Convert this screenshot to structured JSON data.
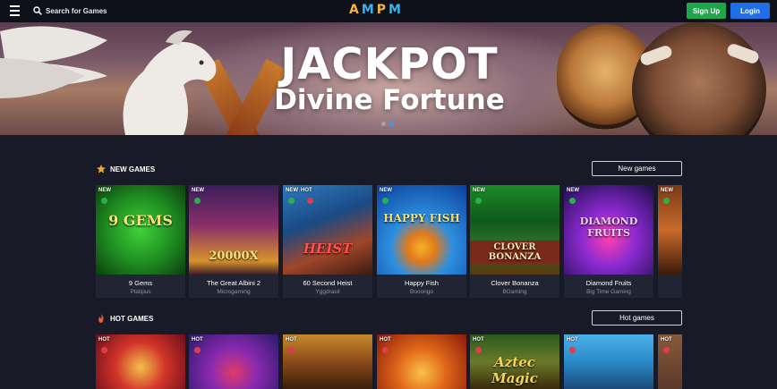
{
  "header": {
    "search_placeholder": "Search for Games",
    "logo_letters": [
      "A",
      "M",
      "P",
      "M"
    ],
    "signup_label": "Sign Up",
    "login_label": "Login"
  },
  "banner": {
    "title": "JACKPOT",
    "subtitle": "Divine Fortune",
    "slide_count": 2,
    "active_slide": 2
  },
  "new_games": {
    "title": "NEW GAMES",
    "button_label": "New games",
    "items": [
      {
        "name": "9 Gems",
        "provider": "Platipus",
        "badges": [
          "NEW"
        ],
        "art": "9 GEMS"
      },
      {
        "name": "The Great Albini 2",
        "provider": "Microgaming",
        "badges": [
          "NEW"
        ],
        "art": "20000X"
      },
      {
        "name": "60 Second Heist",
        "provider": "Yggdrasil",
        "badges": [
          "NEW",
          "HOT"
        ],
        "art": "HEIST"
      },
      {
        "name": "Happy Fish",
        "provider": "Booongo",
        "badges": [
          "NEW"
        ],
        "art": "HAPPY FISH"
      },
      {
        "name": "Clover Bonanza",
        "provider": "BGaming",
        "badges": [
          "NEW"
        ],
        "art": "CLOVER BONANZA"
      },
      {
        "name": "Diamond Fruits",
        "provider": "Big Time Gaming",
        "badges": [
          "NEW"
        ],
        "art": "DIAMOND FRUITS"
      },
      {
        "name": "",
        "provider": "",
        "badges": [
          "NEW"
        ],
        "art": ""
      }
    ]
  },
  "hot_games": {
    "title": "HOT GAMES",
    "button_label": "Hot games",
    "items": [
      {
        "badges": [
          "HOT"
        ]
      },
      {
        "badges": [
          "HOT"
        ]
      },
      {
        "badges": [
          "HOT"
        ]
      },
      {
        "badges": [
          "HOT"
        ]
      },
      {
        "badges": [
          "HOT"
        ],
        "art": "Aztec Magic"
      },
      {
        "badges": [
          "HOT"
        ]
      },
      {
        "badges": [
          "HOT"
        ]
      }
    ]
  },
  "colors": {
    "background": "#181b27",
    "topbar": "#0f111a",
    "signup": "#1fa64a",
    "login": "#1e6fe8",
    "logo_a": "#f2b43c",
    "logo_m": "#39b3e8"
  }
}
